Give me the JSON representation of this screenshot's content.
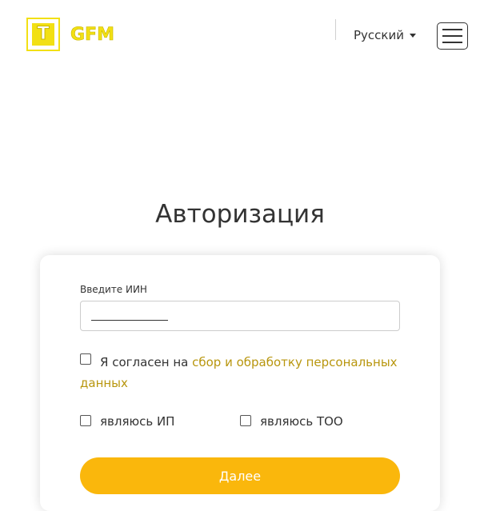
{
  "header": {
    "logo_letter": "T",
    "logo_text": "GFM",
    "language": "Русский"
  },
  "page": {
    "title": "Авторизация"
  },
  "form": {
    "iin_label": "Введите ИИН",
    "iin_value": "",
    "iin_mask": "____________",
    "consent_prefix": "Я согласен на",
    "consent_link": "сбор и обработку персональных данных",
    "consent_checked": false,
    "option_ip_label": "являюсь ИП",
    "option_ip_checked": false,
    "option_too_label": "являюсь ТОО",
    "option_too_checked": false,
    "submit_label": "Далее"
  },
  "colors": {
    "accent": "#fab70c",
    "logo": "#f2e014",
    "link": "#b8960e"
  },
  "icons": {
    "menu": "hamburger-icon",
    "dropdown": "caret-down-icon"
  }
}
